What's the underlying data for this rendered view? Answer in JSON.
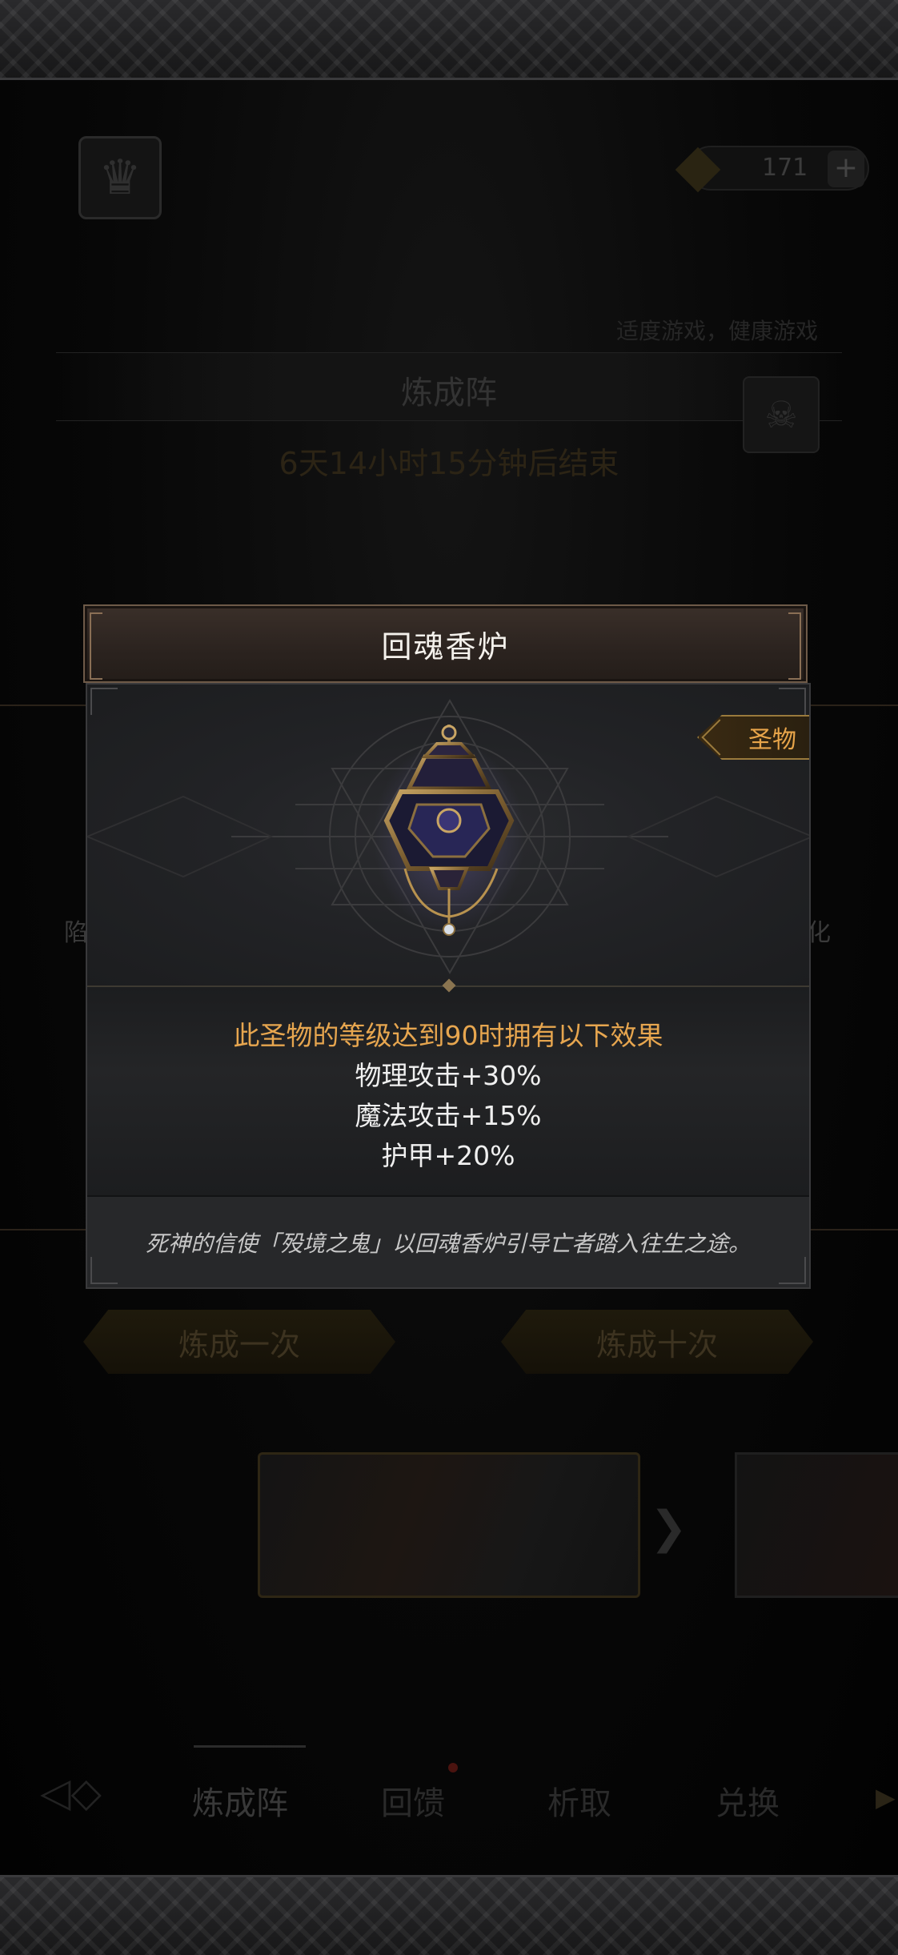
{
  "background": {
    "currency_value": "171",
    "currency_plus": "+",
    "notice": "适度游戏，健康游戏",
    "arena_title": "炼成阵",
    "timer": "6天14小时15分钟后结束",
    "side_left_char": "陷",
    "side_right_char": "化",
    "craft_once_label": "炼成一次",
    "craft_ten_label": "炼成十次",
    "banner_arrow": "❯",
    "nav": {
      "back_icon": "back-arrow-icon",
      "tabs": [
        "炼成阵",
        "回馈",
        "析取",
        "兑换"
      ],
      "more_glyph": "▶"
    }
  },
  "modal": {
    "title": "回魂香炉",
    "category": "圣物",
    "effects_heading": "此圣物的等级达到90时拥有以下效果",
    "effects": [
      "物理攻击+30%",
      "魔法攻击+15%",
      "护甲+20%"
    ],
    "flavor_text": "死神的信使「殁境之鬼」以回魂香炉引导亡者踏入往生之途。"
  },
  "colors": {
    "accent_gold": "#e7a64f",
    "header_border": "#6e5a48",
    "panel_bg": "#1f2022"
  }
}
